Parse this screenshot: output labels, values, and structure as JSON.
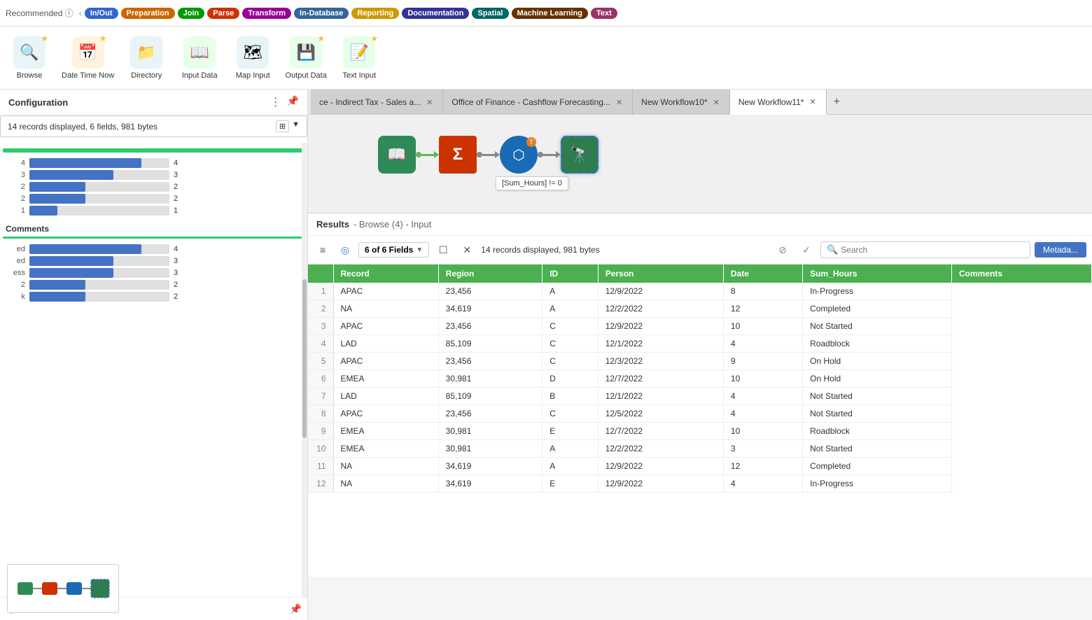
{
  "toolbar": {
    "tags": [
      {
        "label": "In/Out",
        "color": "#3366cc"
      },
      {
        "label": "Preparation",
        "color": "#cc6600"
      },
      {
        "label": "Join",
        "color": "#009900"
      },
      {
        "label": "Parse",
        "color": "#cc3300"
      },
      {
        "label": "Transform",
        "color": "#990099"
      },
      {
        "label": "In-Database",
        "color": "#336699"
      },
      {
        "label": "Reporting",
        "color": "#cc9900"
      },
      {
        "label": "Documentation",
        "color": "#333399"
      },
      {
        "label": "Spatial",
        "color": "#006666"
      },
      {
        "label": "Machine Learning",
        "color": "#663300"
      },
      {
        "label": "Text",
        "color": "#993366"
      }
    ]
  },
  "tools": [
    {
      "label": "Browse",
      "icon": "🔍",
      "bg": "#e8f4f8",
      "starred": true
    },
    {
      "label": "Date Time Now",
      "icon": "📅",
      "bg": "#fff3e0",
      "starred": true
    },
    {
      "label": "Directory",
      "icon": "📁",
      "bg": "#e8f4f8",
      "starred": false
    },
    {
      "label": "Input Data",
      "icon": "📖",
      "bg": "#e8ffe8",
      "starred": false
    },
    {
      "label": "Map Input",
      "icon": "🗺",
      "bg": "#e8f4f8",
      "starred": false
    },
    {
      "label": "Output Data",
      "icon": "💾",
      "bg": "#e8ffe8",
      "starred": true
    },
    {
      "label": "Text Input",
      "icon": "📝",
      "bg": "#e8ffe8",
      "starred": true
    }
  ],
  "left_panel": {
    "title": "Configuration",
    "info_text": "14 records displayed, 6 fields, 981 bytes",
    "region_chart_title": "",
    "region_bars": [
      {
        "label": "4",
        "count": 4,
        "pct": 80
      },
      {
        "label": "3",
        "count": 3,
        "pct": 60
      },
      {
        "label": "2",
        "count": 2,
        "pct": 40
      },
      {
        "label": "2",
        "count": 2,
        "pct": 40
      },
      {
        "label": "1",
        "count": 1,
        "pct": 20
      }
    ],
    "comments_title": "Comments",
    "comments_bars": [
      {
        "label": "ed",
        "count": 4,
        "pct": 80
      },
      {
        "label": "ed",
        "count": 3,
        "pct": 60
      },
      {
        "label": "ess",
        "count": 3,
        "pct": 60
      },
      {
        "label": "2",
        "count": 2,
        "pct": 40
      },
      {
        "label": "k",
        "count": 2,
        "pct": 40
      }
    ]
  },
  "tabs": [
    {
      "label": "ce - Indirect Tax - Sales a...",
      "active": false
    },
    {
      "label": "Office of Finance - Cashflow Forecasting...",
      "active": false
    },
    {
      "label": "New Workflow10*",
      "active": false
    },
    {
      "label": "New Workflow11*",
      "active": true
    }
  ],
  "workflow": {
    "nodes": [
      {
        "type": "input",
        "icon": "📖",
        "bg": "#2e8b57",
        "color": "#fff",
        "selected": false
      },
      {
        "type": "summarize",
        "icon": "Σ",
        "bg": "#cc3300",
        "color": "#fff",
        "selected": false
      },
      {
        "type": "alteryx",
        "icon": "⬡",
        "bg": "#1a6bb5",
        "color": "#fff",
        "selected": false
      },
      {
        "type": "browse",
        "icon": "🔭",
        "bg": "#2e7d4f",
        "color": "#fff",
        "selected": true
      }
    ],
    "condition": "[Sum_Hours] != 0"
  },
  "results": {
    "title": "Results",
    "subtitle": "- Browse (4) - Input",
    "fields_label": "6 of 6 Fields",
    "records_info": "14 records displayed, 981 bytes",
    "search_placeholder": "Search",
    "metadata_label": "Metada...",
    "columns": [
      "Record",
      "Region",
      "ID",
      "Person",
      "Date",
      "Sum_Hours",
      "Comments"
    ],
    "rows": [
      [
        1,
        "APAC",
        "23,456",
        "A",
        "12/9/2022",
        8,
        "In-Progress"
      ],
      [
        2,
        "NA",
        "34,619",
        "A",
        "12/2/2022",
        12,
        "Completed"
      ],
      [
        3,
        "APAC",
        "23,456",
        "C",
        "12/9/2022",
        10,
        "Not Started"
      ],
      [
        4,
        "LAD",
        "85,109",
        "C",
        "12/1/2022",
        4,
        "Roadblock"
      ],
      [
        5,
        "APAC",
        "23,456",
        "C",
        "12/3/2022",
        9,
        "On Hold"
      ],
      [
        6,
        "EMEA",
        "30,981",
        "D",
        "12/7/2022",
        10,
        "On Hold"
      ],
      [
        7,
        "LAD",
        "85,109",
        "B",
        "12/1/2022",
        4,
        "Not Started"
      ],
      [
        8,
        "APAC",
        "23,456",
        "C",
        "12/5/2022",
        4,
        "Not Started"
      ],
      [
        9,
        "EMEA",
        "30,981",
        "E",
        "12/7/2022",
        10,
        "Roadblock"
      ],
      [
        10,
        "EMEA",
        "30,981",
        "A",
        "12/2/2022",
        3,
        "Not Started"
      ],
      [
        11,
        "NA",
        "34,619",
        "A",
        "12/9/2022",
        12,
        "Completed"
      ],
      [
        12,
        "NA",
        "34,619",
        "E",
        "12/9/2022",
        4,
        "In-Progress"
      ]
    ]
  }
}
